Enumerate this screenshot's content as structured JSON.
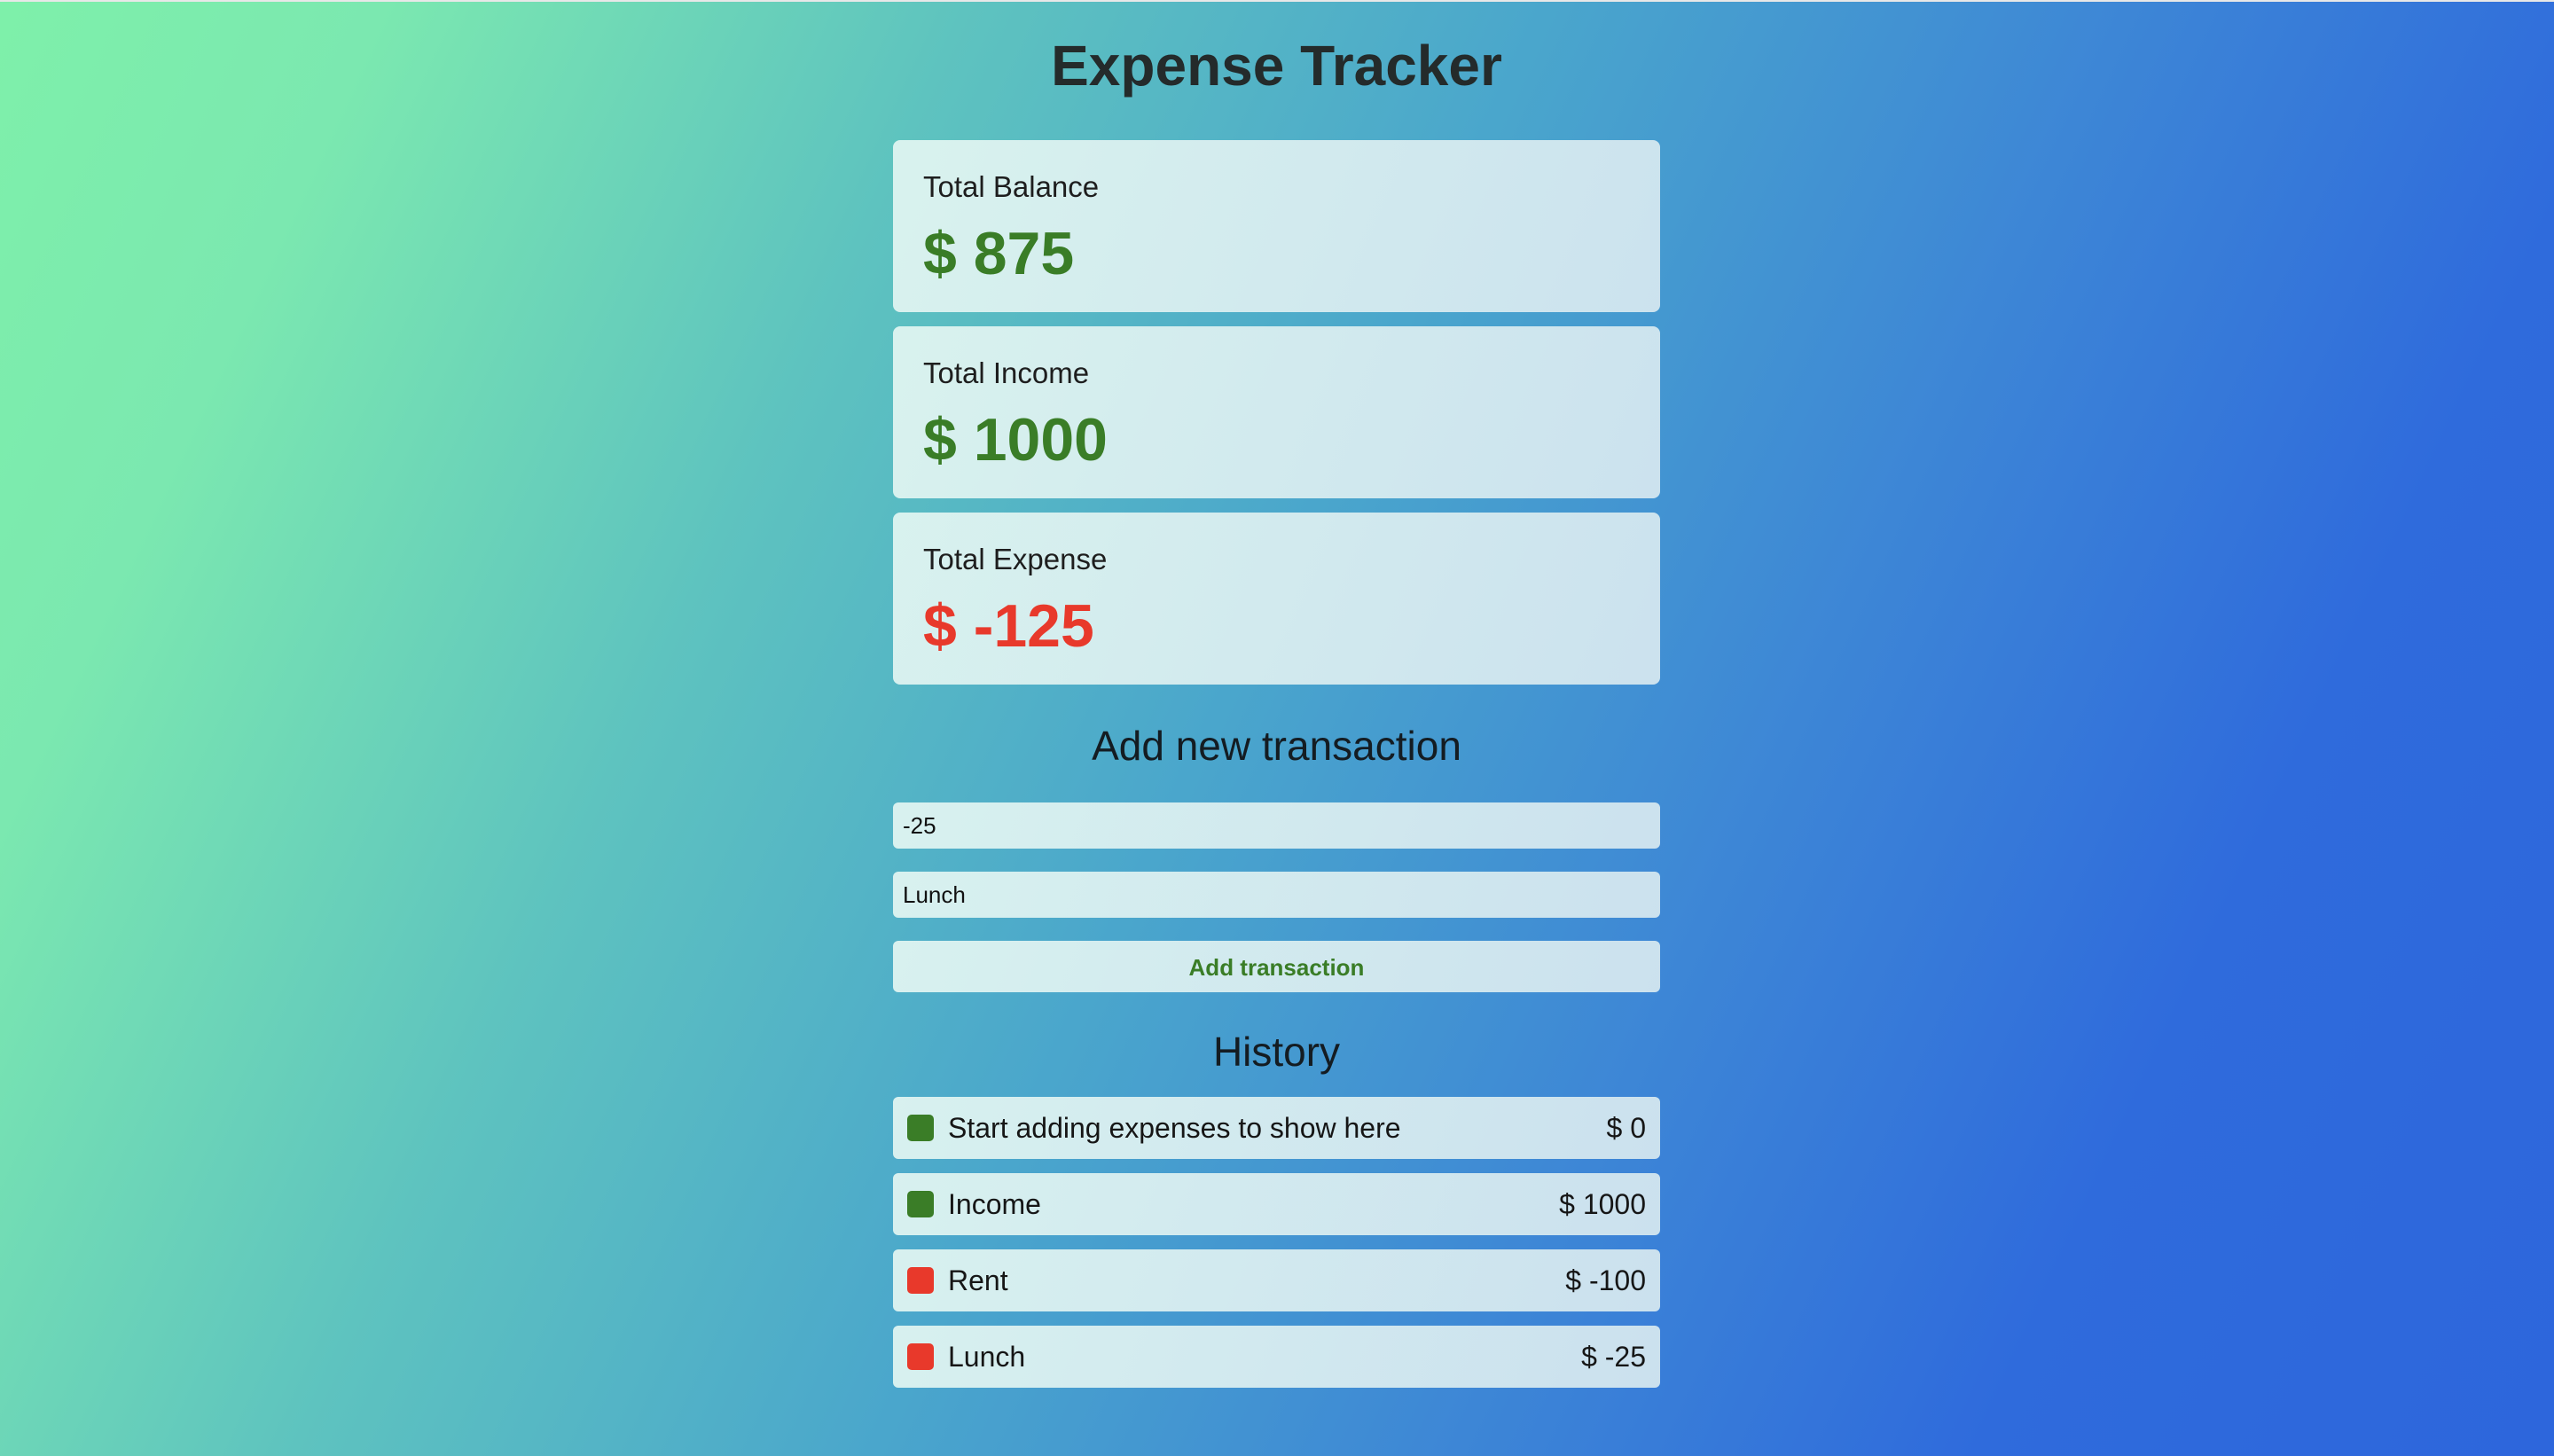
{
  "app": {
    "title": "Expense Tracker"
  },
  "summary": {
    "balance": {
      "label": "Total Balance",
      "amount": "$ 875"
    },
    "income": {
      "label": "Total Income",
      "amount": "$ 1000"
    },
    "expense": {
      "label": "Total Expense",
      "amount": "$ -125"
    }
  },
  "form": {
    "heading": "Add new transaction",
    "amount_value": "-25",
    "description_value": "Lunch",
    "submit_label": "Add transaction"
  },
  "history": {
    "heading": "History",
    "items": [
      {
        "name": "Start adding expenses to show here",
        "amount": "$ 0",
        "type": "income"
      },
      {
        "name": "Income",
        "amount": "$ 1000",
        "type": "income"
      },
      {
        "name": "Rent",
        "amount": "$ -100",
        "type": "expense"
      },
      {
        "name": "Lunch",
        "amount": "$ -25",
        "type": "expense"
      }
    ]
  },
  "colors": {
    "positive": "#3a7d27",
    "negative": "#e8392b"
  }
}
